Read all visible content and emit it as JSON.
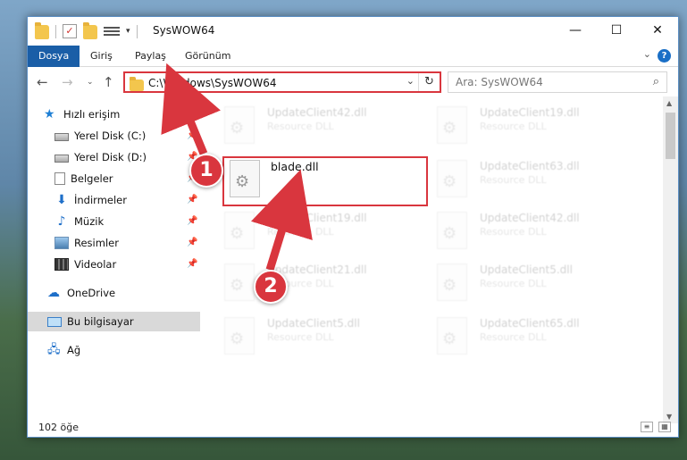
{
  "window": {
    "title": "SysWOW64",
    "controls": {
      "minimize": "—",
      "maximize": "☐",
      "close": "✕"
    }
  },
  "ribbon": {
    "tabs": [
      "Dosya",
      "Giriş",
      "Paylaş",
      "Görünüm"
    ],
    "active_tab": "Dosya"
  },
  "address": {
    "path": "C:\\Windows\\SysWOW64",
    "search_placeholder": "Ara: SysWOW64"
  },
  "nav": {
    "quick_access": "Hızlı erişim",
    "items": [
      {
        "label": "Yerel Disk (C:)",
        "icon": "drive-icon",
        "pinned": true
      },
      {
        "label": "Yerel Disk (D:)",
        "icon": "drive-icon",
        "pinned": true
      },
      {
        "label": "Belgeler",
        "icon": "documents-icon",
        "pinned": true
      },
      {
        "label": "İndirmeler",
        "icon": "downloads-icon",
        "pinned": true
      },
      {
        "label": "Müzik",
        "icon": "music-icon",
        "pinned": true
      },
      {
        "label": "Resimler",
        "icon": "pictures-icon",
        "pinned": true
      },
      {
        "label": "Videolar",
        "icon": "videos-icon",
        "pinned": true
      }
    ],
    "onedrive": "OneDrive",
    "this_pc": "Bu bilgisayar",
    "network": "Ağ"
  },
  "files": {
    "highlighted": {
      "name": "blade.dll",
      "type": ""
    },
    "background": [
      {
        "name": "UpdateClient42.dll",
        "type": "Resource DLL"
      },
      {
        "name": "UpdateClient19.dll",
        "type": "Resource DLL"
      },
      {
        "name": "UpdateClient63.dll",
        "type": "Resource DLL"
      },
      {
        "name": "UpdateClient19.dll",
        "type": "Resource DLL"
      },
      {
        "name": "UpdateClient42.dll",
        "type": "Resource DLL"
      },
      {
        "name": "UpdateClient21.dll",
        "type": "Resource DLL"
      },
      {
        "name": "UpdateClient5.dll",
        "type": "Resource DLL"
      },
      {
        "name": "UpdateClient5.dll",
        "type": "Resource DLL"
      },
      {
        "name": "UpdateClient65.dll",
        "type": "Resource DLL"
      }
    ]
  },
  "status": {
    "item_count": "102 öğe"
  },
  "annotations": {
    "step1": "1",
    "step2": "2",
    "color": "#d9363e"
  }
}
